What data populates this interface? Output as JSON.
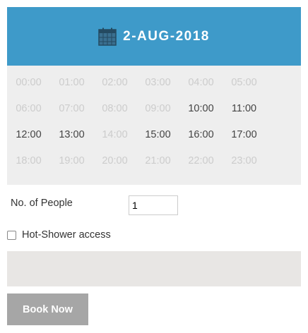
{
  "header": {
    "icon": "calendar-icon",
    "date": "2-AUG-2018",
    "background": "#3e9ac9"
  },
  "time_slots": [
    {
      "label": "00:00",
      "available": false
    },
    {
      "label": "01:00",
      "available": false
    },
    {
      "label": "02:00",
      "available": false
    },
    {
      "label": "03:00",
      "available": false
    },
    {
      "label": "04:00",
      "available": false
    },
    {
      "label": "05:00",
      "available": false
    },
    {
      "label": "06:00",
      "available": false
    },
    {
      "label": "07:00",
      "available": false
    },
    {
      "label": "08:00",
      "available": false
    },
    {
      "label": "09:00",
      "available": false
    },
    {
      "label": "10:00",
      "available": true
    },
    {
      "label": "11:00",
      "available": true
    },
    {
      "label": "12:00",
      "available": true
    },
    {
      "label": "13:00",
      "available": true
    },
    {
      "label": "14:00",
      "available": false
    },
    {
      "label": "15:00",
      "available": true
    },
    {
      "label": "16:00",
      "available": true
    },
    {
      "label": "17:00",
      "available": true
    },
    {
      "label": "18:00",
      "available": false
    },
    {
      "label": "19:00",
      "available": false
    },
    {
      "label": "20:00",
      "available": false
    },
    {
      "label": "21:00",
      "available": false
    },
    {
      "label": "22:00",
      "available": false
    },
    {
      "label": "23:00",
      "available": false
    }
  ],
  "people": {
    "label": "No. of People",
    "value": "1"
  },
  "shower": {
    "label": "Hot-Shower access",
    "checked": false
  },
  "book_button": {
    "label": "Book Now"
  }
}
